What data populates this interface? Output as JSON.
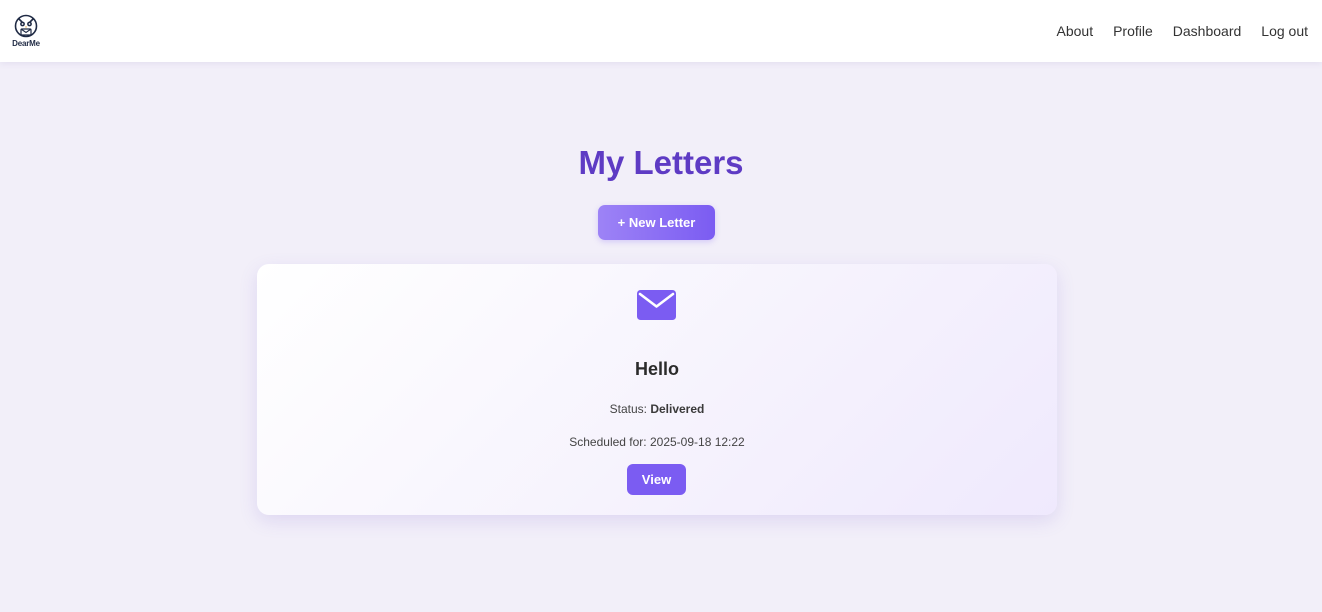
{
  "brand": {
    "name": "DearMe",
    "logo_icon": "owl-mail-logo-icon"
  },
  "nav": {
    "links": [
      {
        "label": "About"
      },
      {
        "label": "Profile"
      },
      {
        "label": "Dashboard"
      },
      {
        "label": "Log out"
      }
    ]
  },
  "page": {
    "title": "My Letters",
    "new_letter_label": "+ New Letter"
  },
  "letters": [
    {
      "icon": "envelope-icon",
      "title": "Hello",
      "status_label": "Status:",
      "status_value": "Delivered",
      "scheduled_label": "Scheduled for:",
      "scheduled_value": "2025-09-18 12:22",
      "view_label": "View"
    }
  ],
  "colors": {
    "accent": "#7b5cf2",
    "title": "#5e3bc4",
    "background": "#f2eff9"
  }
}
